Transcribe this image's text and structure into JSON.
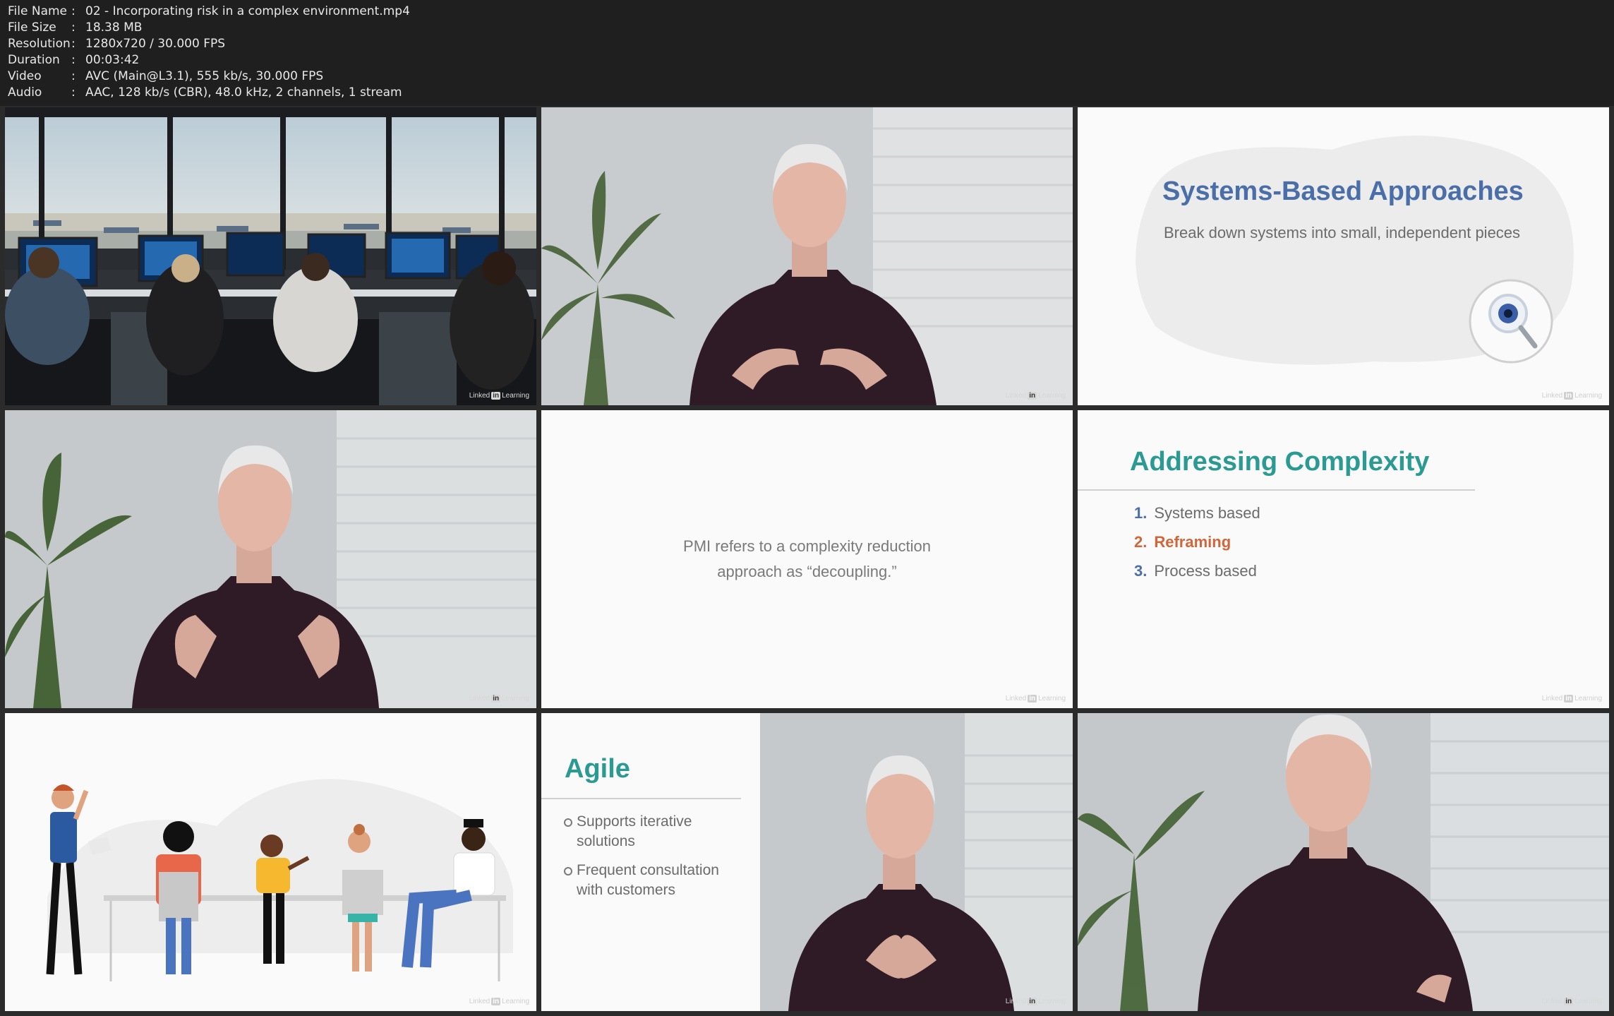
{
  "info": [
    {
      "key": "File Name",
      "value": "02 - Incorporating risk in a complex environment.mp4"
    },
    {
      "key": "File Size",
      "value": "18.38 MB"
    },
    {
      "key": "Resolution",
      "value": "1280x720 / 30.000 FPS"
    },
    {
      "key": "Duration",
      "value": "00:03:42"
    },
    {
      "key": "Video",
      "value": "AVC (Main@L3.1), 555 kb/s, 30.000 FPS"
    },
    {
      "key": "Audio",
      "value": "AAC, 128 kb/s (CBR), 48.0 kHz, 2 channels, 1 stream"
    }
  ],
  "separator": ":",
  "watermark": {
    "brand": "Linked",
    "badge": "in",
    "suffix": "Learning"
  },
  "slides": {
    "systems": {
      "title": "Systems-Based Approaches",
      "subtitle": "Break down systems into small, independent pieces"
    },
    "pmi": {
      "line1": "PMI refers to a complexity reduction",
      "line2": "approach as “decoupling.”"
    },
    "addressing": {
      "title": "Addressing Complexity",
      "items": [
        {
          "num": "1.",
          "label": "Systems based"
        },
        {
          "num": "2.",
          "label": "Reframing"
        },
        {
          "num": "3.",
          "label": "Process based"
        }
      ]
    },
    "agile": {
      "title": "Agile",
      "bullets": [
        {
          "line1": "Supports iterative",
          "line2": "solutions"
        },
        {
          "line1": "Frequent consultation",
          "line2": "with customers"
        }
      ]
    }
  },
  "colors": {
    "header_bg": "#1f1f1f",
    "teal": "#2a9a93",
    "blue": "#4a6fa8",
    "orange": "#d2663a",
    "shirt": "#2e1b26"
  }
}
